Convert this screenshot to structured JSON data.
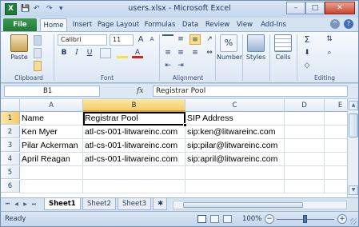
{
  "window": {
    "title": "users.xlsx - Microsoft Excel",
    "logo_letter": "X",
    "controls": {
      "minimize": "–",
      "maximize": "□",
      "close": "✕"
    }
  },
  "qat": {
    "save": "💾",
    "undo": "↶",
    "redo": "↷",
    "customize": "▾"
  },
  "ribbon_tabs": [
    "File",
    "Home",
    "Insert",
    "Page Layout",
    "Formulas",
    "Data",
    "Review",
    "View",
    "Add-Ins"
  ],
  "active_tab": "Home",
  "help_icons": {
    "minimize_ribbon": "^",
    "help": "?"
  },
  "ribbon": {
    "clipboard": {
      "label": "Clipboard",
      "paste": "Paste"
    },
    "font": {
      "label": "Font",
      "name": "Calibri",
      "size": "11",
      "bold": "B",
      "italic": "I",
      "underline": "U",
      "grow": "A",
      "shrink": "A",
      "fontcolor": "A"
    },
    "alignment": {
      "label": "Alignment"
    },
    "number": {
      "label": "Number",
      "symbol": "%"
    },
    "styles": {
      "label": "Styles"
    },
    "cells": {
      "label": "Cells"
    },
    "editing": {
      "label": "Editing",
      "sum": "Σ"
    }
  },
  "formula_bar": {
    "name_box": "B1",
    "fx": "fx",
    "content": "Registrar Pool"
  },
  "columns": [
    "A",
    "B",
    "C",
    "D",
    "E"
  ],
  "rows": [
    "1",
    "2",
    "3",
    "4",
    "5",
    "6"
  ],
  "cells": [
    [
      "Name",
      "Registrar Pool",
      "SIP Address"
    ],
    [
      "Ken Myer",
      "atl-cs-001-litwareinc.com",
      "sip:ken@litwareinc.com"
    ],
    [
      "Pilar Ackerman",
      "atl-cs-001-litwareinc.com",
      "sip:pilar@litwareinc.com"
    ],
    [
      "April Reagan",
      "atl-cs-001-litwareinc.com",
      "sip:april@litwareinc.com"
    ]
  ],
  "sheets": [
    "Sheet1",
    "Sheet2",
    "Sheet3"
  ],
  "active_sheet": "Sheet1",
  "status": {
    "ready": "Ready",
    "zoom": "100%",
    "zoom_minus": "−",
    "zoom_plus": "+"
  },
  "colors": {
    "excel_green": "#217a36",
    "selection": "#f5cc6a"
  }
}
